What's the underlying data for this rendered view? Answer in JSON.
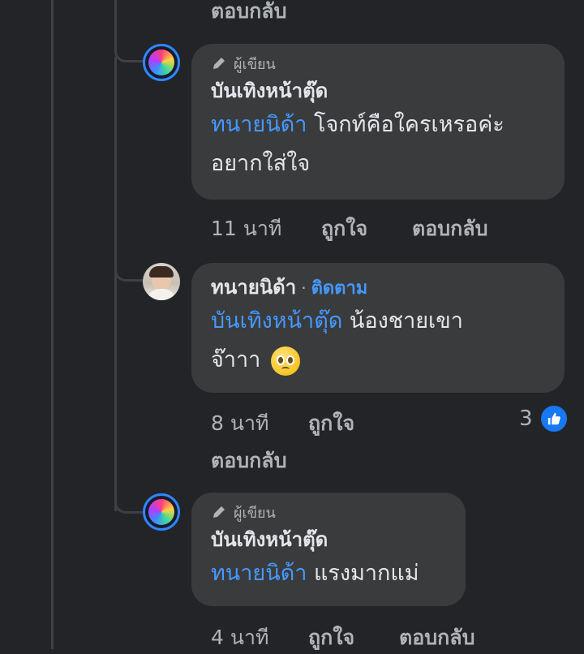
{
  "top": {
    "reply_label": "ตอบกลับ"
  },
  "comments": [
    {
      "author_badge": "ผู้เขียน",
      "name": "บันเทิงหน้าตุ๊ด",
      "mention": "ทนายนิด้า",
      "text_line1": "โจกท์คือใครเหรอค่ะ",
      "text_line2": "อยากใส่ใจ",
      "time": "11 นาที",
      "like_label": "ถูกใจ",
      "reply_label": "ตอบกลับ"
    },
    {
      "name": "ทนายนิด้า",
      "separator": "·",
      "follow_label": "ติดตาม",
      "mention": "บันเทิงหน้าตุ๊ด",
      "text_line1": "น้องชายเขา",
      "text_line2": "จ๊าาา",
      "emoji": "pleading-face",
      "time": "8 นาที",
      "like_label": "ถูกใจ",
      "reply_label": "ตอบกลับ",
      "reaction_count": "3"
    },
    {
      "author_badge": "ผู้เขียน",
      "name": "บันเทิงหน้าตุ๊ด",
      "mention": "ทนายนิด้า",
      "text": "แรงมากแม่",
      "time": "4 นาที",
      "like_label": "ถูกใจ",
      "reply_label": "ตอบกลับ"
    }
  ],
  "colors": {
    "background": "#232427",
    "bubble": "#3a3b3c",
    "accent": "#4599ff",
    "like": "#1877f2"
  }
}
